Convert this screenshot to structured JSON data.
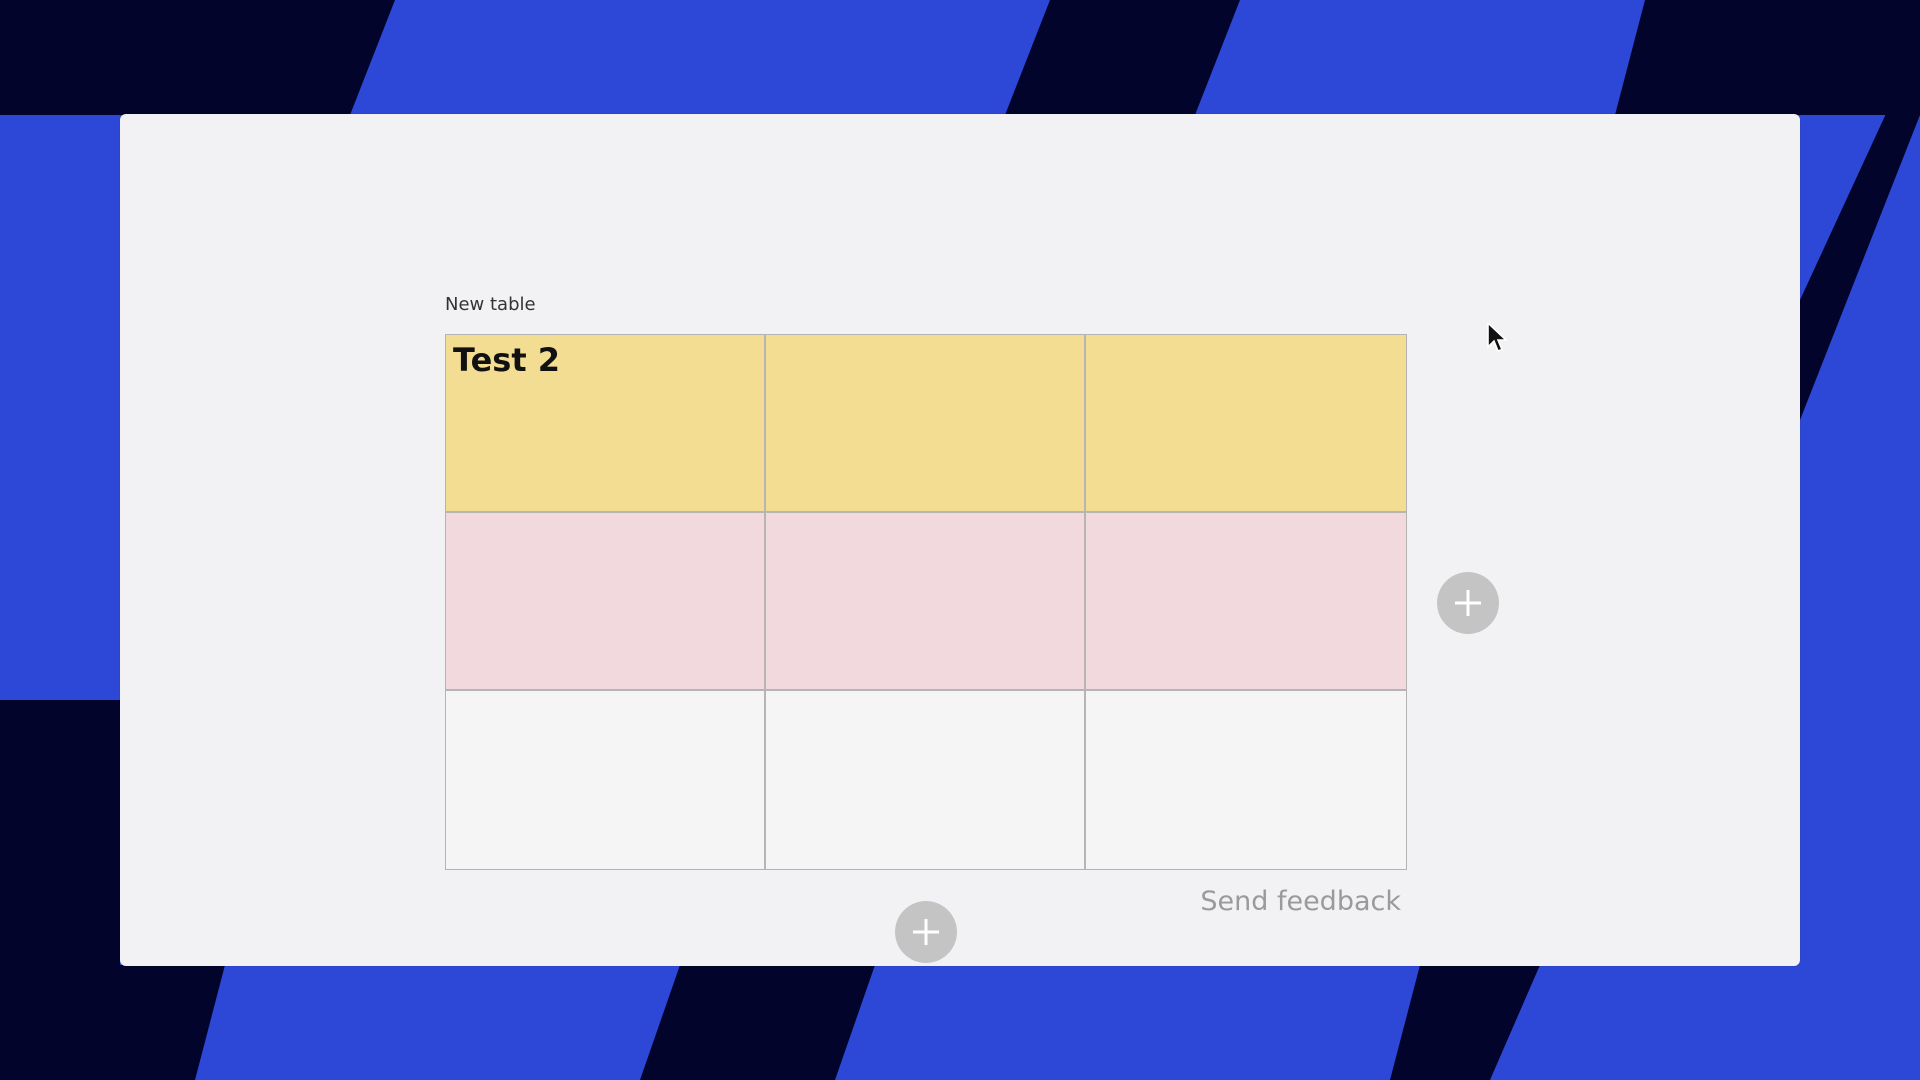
{
  "table": {
    "title": "New table",
    "rows": [
      {
        "color": "#f2dd93",
        "cells": [
          "Test 2",
          "",
          ""
        ]
      },
      {
        "color": "#f2d9dd",
        "cells": [
          "",
          "",
          ""
        ]
      },
      {
        "color": "#f5f5f5",
        "cells": [
          "",
          "",
          ""
        ]
      }
    ]
  },
  "actions": {
    "add_column_icon": "plus-icon",
    "add_row_icon": "plus-icon",
    "send_feedback": "Send feedback"
  },
  "theme": {
    "background_blue": "#2d48d6",
    "background_navy": "#02042c",
    "board": "#f2f2f4",
    "button_gray": "#c4c4c4"
  }
}
